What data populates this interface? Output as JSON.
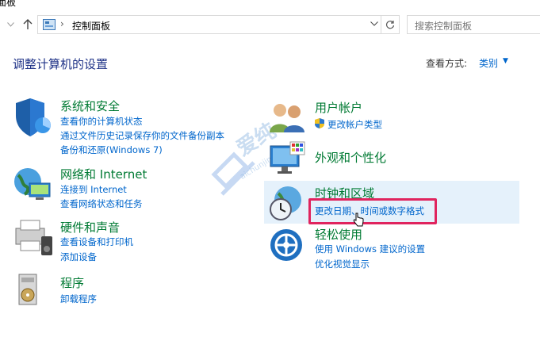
{
  "window": {
    "title": "面板"
  },
  "nav": {
    "back_icon": "back-arrow-icon",
    "forward_icon": "forward-arrow-icon",
    "recent_icon": "chevron-down-icon",
    "up_icon": "up-arrow-icon"
  },
  "address": {
    "separator": "›",
    "path": "控制面板",
    "dropdown": "⌄",
    "refresh": "↻"
  },
  "search": {
    "placeholder": "搜索控制面板"
  },
  "header": {
    "title": "调整计算机的设置",
    "view_by_label": "查看方式:",
    "view_by_value": "类别",
    "caret": "▼"
  },
  "categories": {
    "system": {
      "title": "系统和安全",
      "links": [
        "查看你的计算机状态",
        "通过文件历史记录保存你的文件备份副本",
        "备份和还原(Windows 7)"
      ]
    },
    "network": {
      "title": "网络和 Internet",
      "links": [
        "连接到 Internet",
        "查看网络状态和任务"
      ]
    },
    "hardware": {
      "title": "硬件和声音",
      "links": [
        "查看设备和打印机",
        "添加设备"
      ]
    },
    "programs": {
      "title": "程序",
      "links": [
        "卸载程序"
      ]
    },
    "accounts": {
      "title": "用户帐户",
      "links": [
        "更改帐户类型"
      ]
    },
    "appearance": {
      "title": "外观和个性化",
      "links": []
    },
    "clock": {
      "title": "时钟和区域",
      "links": [
        "更改日期、时间或数字格式"
      ]
    },
    "ease": {
      "title": "轻松使用",
      "links": [
        "使用 Windows 建议的设置",
        "优化视觉显示"
      ]
    }
  },
  "watermark": {
    "text": "爱纯",
    "sub": "aichunjing"
  },
  "colors": {
    "link": "#0066cc",
    "category": "#007a33",
    "title": "#1e3287",
    "highlight": "#e0245e",
    "hover": "#e5f1fb"
  }
}
